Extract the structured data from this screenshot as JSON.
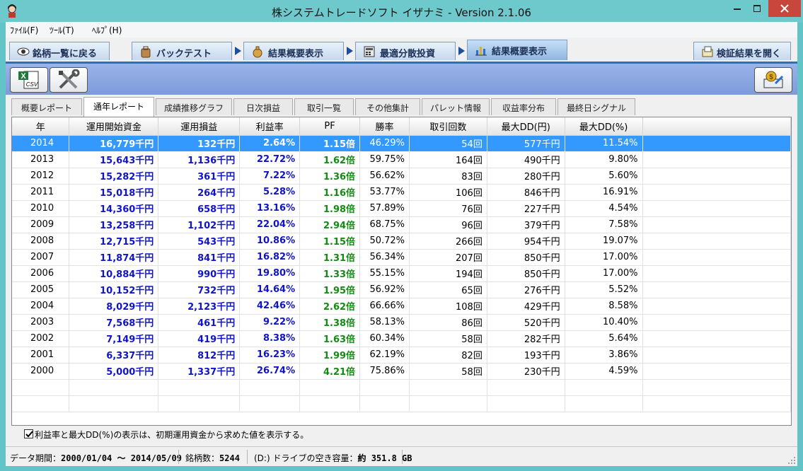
{
  "window": {
    "title": "株システムトレードソフト イザナミ - Version 2.1.06"
  },
  "menu": [
    {
      "label": "ﾌｧｲﾙ(F)"
    },
    {
      "label": "ﾂｰﾙ(T)"
    },
    {
      "label": "ﾍﾙﾌﾟ(H)"
    }
  ],
  "nav": {
    "back_label": "銘柄一覧に戻る",
    "steps": [
      {
        "label": "バックテスト"
      },
      {
        "label": "結果概要表示"
      },
      {
        "label": "最適分散投資"
      },
      {
        "label": "結果概要表示"
      }
    ],
    "open_label": "検証結果を開く"
  },
  "toolbar": {
    "csv_label": "CSV"
  },
  "subtabs": [
    {
      "label": "概要レポート"
    },
    {
      "label": "通年レポート"
    },
    {
      "label": "成績推移グラフ"
    },
    {
      "label": "日次損益"
    },
    {
      "label": "取引一覧"
    },
    {
      "label": "その他集計"
    },
    {
      "label": "パレット情報"
    },
    {
      "label": "収益率分布"
    },
    {
      "label": "最終日シグナル"
    }
  ],
  "table": {
    "headers": [
      "年",
      "運用開始資金",
      "運用損益",
      "利益率",
      "PF",
      "勝率",
      "取引回数",
      "最大DD(円)",
      "最大DD(%)"
    ],
    "rows": [
      [
        "2014",
        "16,779千円",
        "132千円",
        "2.64%",
        "1.15倍",
        "46.29%",
        "54回",
        "577千円",
        "11.54%"
      ],
      [
        "2013",
        "15,643千円",
        "1,136千円",
        "22.72%",
        "1.62倍",
        "59.75%",
        "164回",
        "490千円",
        "9.80%"
      ],
      [
        "2012",
        "15,282千円",
        "361千円",
        "7.22%",
        "1.36倍",
        "56.62%",
        "83回",
        "280千円",
        "5.60%"
      ],
      [
        "2011",
        "15,018千円",
        "264千円",
        "5.28%",
        "1.16倍",
        "53.77%",
        "106回",
        "846千円",
        "16.91%"
      ],
      [
        "2010",
        "14,360千円",
        "658千円",
        "13.16%",
        "1.98倍",
        "57.89%",
        "76回",
        "227千円",
        "4.54%"
      ],
      [
        "2009",
        "13,258千円",
        "1,102千円",
        "22.04%",
        "2.94倍",
        "68.75%",
        "96回",
        "379千円",
        "7.58%"
      ],
      [
        "2008",
        "12,715千円",
        "543千円",
        "10.86%",
        "1.15倍",
        "50.72%",
        "266回",
        "954千円",
        "19.07%"
      ],
      [
        "2007",
        "11,874千円",
        "841千円",
        "16.82%",
        "1.31倍",
        "56.34%",
        "207回",
        "850千円",
        "17.00%"
      ],
      [
        "2006",
        "10,884千円",
        "990千円",
        "19.80%",
        "1.33倍",
        "55.15%",
        "194回",
        "850千円",
        "17.00%"
      ],
      [
        "2005",
        "10,152千円",
        "732千円",
        "14.64%",
        "1.95倍",
        "56.92%",
        "65回",
        "276千円",
        "5.52%"
      ],
      [
        "2004",
        "8,029千円",
        "2,123千円",
        "42.46%",
        "2.62倍",
        "66.66%",
        "108回",
        "429千円",
        "8.58%"
      ],
      [
        "2003",
        "7,568千円",
        "461千円",
        "9.22%",
        "1.38倍",
        "58.13%",
        "86回",
        "520千円",
        "10.40%"
      ],
      [
        "2002",
        "7,149千円",
        "419千円",
        "8.38%",
        "1.63倍",
        "60.34%",
        "58回",
        "282千円",
        "5.64%"
      ],
      [
        "2001",
        "6,337千円",
        "812千円",
        "16.23%",
        "1.99倍",
        "62.19%",
        "82回",
        "193千円",
        "3.86%"
      ],
      [
        "2000",
        "5,000千円",
        "1,337千円",
        "26.74%",
        "4.21倍",
        "75.86%",
        "58回",
        "230千円",
        "4.59%"
      ]
    ]
  },
  "note": {
    "checked": true,
    "text": "利益率と最大DD(%)の表示は、初期運用資金から求めた値を表示する。"
  },
  "status": {
    "period_label": "データ期間：",
    "period_value": "2000/01/04 〜 2014/05/09",
    "count_label": "銘柄数：",
    "count_value": "5244",
    "drive_label": "(D:) ドライブの空き容量：",
    "drive_value": "約 351.8 GB"
  },
  "colors": {
    "titlebar": "#6ec9cc",
    "selected_row": "#3399ff",
    "blue_value": "#1014c8",
    "green_value": "#148a14",
    "close_button": "#c9463d"
  }
}
